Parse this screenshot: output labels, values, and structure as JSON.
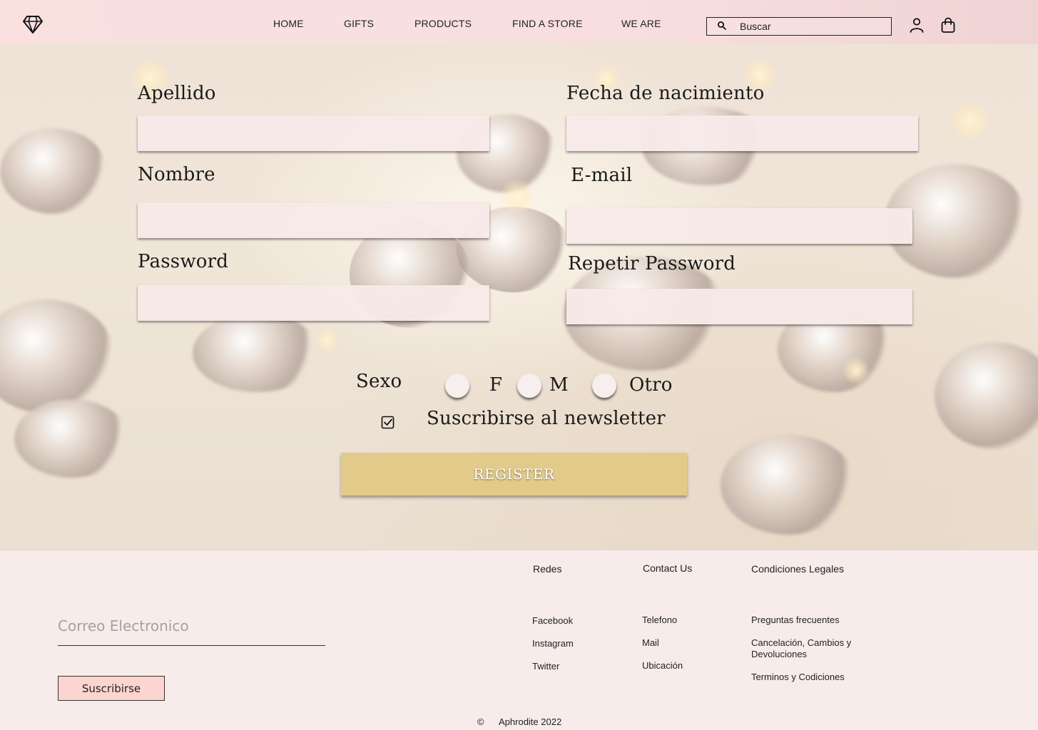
{
  "header": {
    "nav": [
      "HOME",
      "GIFTS",
      "PRODUCTS",
      "FIND A STORE",
      "WE ARE"
    ],
    "search": {
      "placeholder": "Buscar"
    },
    "icons": [
      "diamond-logo-icon",
      "search-icon",
      "user-icon",
      "shopping-bag-icon"
    ]
  },
  "form": {
    "apellido_label": "Apellido",
    "fecha_label": "Fecha de nacimiento",
    "nombre_label": "Nombre",
    "email_label": "E-mail",
    "password_label": "Password",
    "repeat_password_label": "Repetir Password",
    "sexo_label": "Sexo",
    "sexo_options": [
      "F",
      "M",
      "Otro"
    ],
    "newsletter_label": "Suscribirse al newsletter",
    "newsletter_checked": true,
    "register_label": "REGISTER"
  },
  "footer": {
    "email_placeholder": "Correo Electronico",
    "subscribe_label": "Suscribirse",
    "redes": {
      "title": "Redes",
      "links": [
        "Facebook",
        "Instagram",
        "Twitter"
      ]
    },
    "contact": {
      "title": "Contact Us",
      "links": [
        "Telefono",
        "Mail",
        "Ubicación"
      ]
    },
    "legal": {
      "title": "Condiciones Legales",
      "links": [
        "Preguntas frecuentes",
        "Cancelación, Cambios y Devoluciones",
        "Terminos y Codiciones"
      ]
    },
    "copyright_symbol": "©",
    "copyright_text": "Aphrodite 2022"
  },
  "colors": {
    "header_bg": "#f9e1e1",
    "field_bg": "#f7e9e8",
    "register_bg": "#e2cb8a",
    "footer_bg": "#f7ecea",
    "subscribe_bg": "#fcd4d0"
  }
}
